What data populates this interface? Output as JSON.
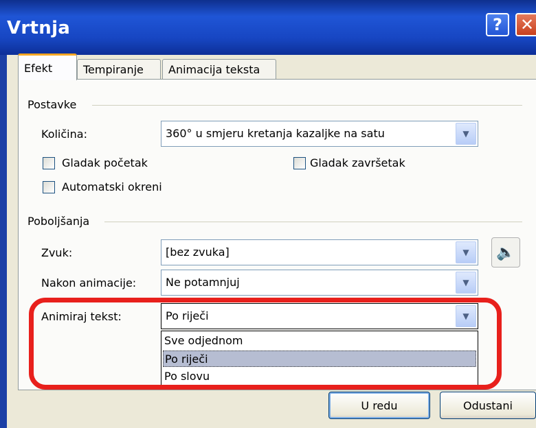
{
  "window": {
    "title": "Vrtnja",
    "help_label": "?",
    "close_label": "✕"
  },
  "tabs": [
    {
      "label": "Efekt",
      "active": true
    },
    {
      "label": "Tempiranje",
      "active": false
    },
    {
      "label": "Animacija teksta",
      "active": false
    }
  ],
  "postavke": {
    "group_label": "Postavke",
    "kolicina_label": "Količina:",
    "kolicina_value": "360° u smjeru kretanja kazaljke na satu",
    "gladak_pocetak": {
      "label": "Gladak početak",
      "checked": false
    },
    "gladak_zavrsetak": {
      "label": "Gladak završetak",
      "checked": false
    },
    "automatski_okreni": {
      "label": "Automatski okreni",
      "checked": false
    }
  },
  "poboljsanja": {
    "group_label": "Poboljšanja",
    "zvuk_label": "Zvuk:",
    "zvuk_value": "[bez zvuka]",
    "nakon_label": "Nakon animacije:",
    "nakon_value": "Ne potamnjuj",
    "animiraj_label": "Animiraj tekst:",
    "animiraj_value": "Po riječi",
    "animiraj_options": [
      "Sve odjednom",
      "Po riječi",
      "Po slovu"
    ],
    "animiraj_selected": "Po riječi"
  },
  "buttons": {
    "ok": "U redu",
    "cancel": "Odustani"
  },
  "icons": {
    "dropdown": "chevron-down-icon",
    "speaker": "speaker-icon"
  },
  "colors": {
    "title_bar": "#1f55d6",
    "highlight_ring": "#e8201c",
    "tab_accent": "#f5a623"
  }
}
